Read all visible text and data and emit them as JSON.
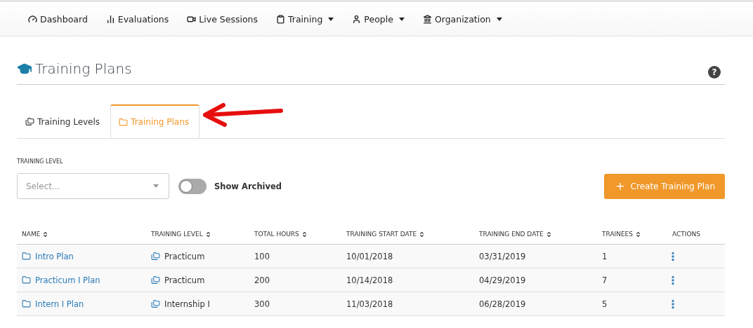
{
  "nav": [
    {
      "label": "Dashboard",
      "dropdown": false
    },
    {
      "label": "Evaluations",
      "dropdown": false
    },
    {
      "label": "Live Sessions",
      "dropdown": false
    },
    {
      "label": "Training",
      "dropdown": true
    },
    {
      "label": "People",
      "dropdown": true
    },
    {
      "label": "Organization",
      "dropdown": true
    }
  ],
  "page": {
    "title": "Training Plans",
    "help": "?"
  },
  "tabs": [
    {
      "label": "Training Levels",
      "selected": false
    },
    {
      "label": "Training Plans",
      "selected": true
    }
  ],
  "filter": {
    "label": "TRAINING LEVEL",
    "placeholder": "Select...",
    "toggle_label": "Show Archived",
    "toggle_on": false
  },
  "create_button": {
    "icon": "+",
    "label": "Create Training Plan"
  },
  "table": {
    "columns": [
      {
        "label": "NAME",
        "sortable": true
      },
      {
        "label": "TRAINING LEVEL",
        "sortable": true
      },
      {
        "label": "TOTAL HOURS",
        "sortable": true
      },
      {
        "label": "TRAINING START DATE",
        "sortable": true
      },
      {
        "label": "TRAINING END DATE",
        "sortable": true
      },
      {
        "label": "TRAINEES",
        "sortable": true
      },
      {
        "label": "ACTIONS",
        "sortable": false
      }
    ],
    "rows": [
      {
        "name": "Intro Plan",
        "level": "Practicum",
        "hours": "100",
        "start": "10/01/2018",
        "end": "03/31/2019",
        "trainees": "1"
      },
      {
        "name": "Practicum I Plan",
        "level": "Practicum",
        "hours": "200",
        "start": "10/14/2018",
        "end": "04/29/2019",
        "trainees": "7"
      },
      {
        "name": "Intern I Plan",
        "level": "Internship I",
        "hours": "300",
        "start": "11/03/2018",
        "end": "06/28/2019",
        "trainees": "5"
      }
    ]
  }
}
